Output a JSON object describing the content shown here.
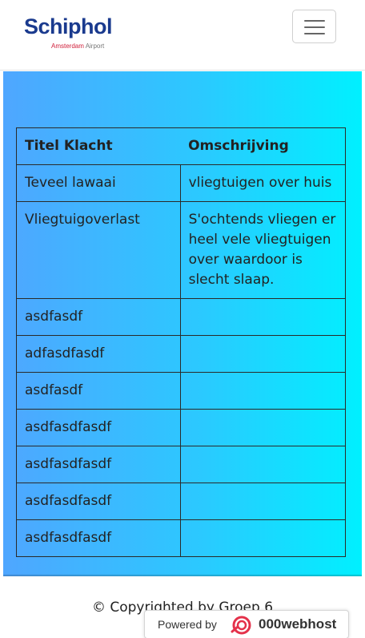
{
  "header": {
    "logo_text": "Schiphol",
    "logo_sub_red": "Amsterdam",
    "logo_sub_grey": "Airport",
    "menu_icon": "hamburger-icon"
  },
  "table": {
    "headers": [
      "Titel Klacht",
      "Omschrijving"
    ],
    "rows": [
      {
        "title": "Teveel lawaai",
        "description": "vliegtuigen over huis"
      },
      {
        "title": "Vliegtuigoverlast",
        "description": "S'ochtends vliegen er heel vele vliegtuigen over waardoor is slecht slaap."
      },
      {
        "title": "asdfasdf",
        "description": ""
      },
      {
        "title": "adfasdfasdf",
        "description": ""
      },
      {
        "title": "asdfasdf",
        "description": ""
      },
      {
        "title": "asdfasdfasdf",
        "description": ""
      },
      {
        "title": "asdfasdfasdf",
        "description": ""
      },
      {
        "title": "asdfasdfasdf",
        "description": ""
      },
      {
        "title": "asdfasdfasdf",
        "description": ""
      }
    ]
  },
  "footer": {
    "copyright": "© Copyrighted by Groep 6",
    "powered_by": "Powered by",
    "host_name": "000webhost",
    "host_icon": "000webhost-logo-icon"
  },
  "colors": {
    "brand_blue": "#1a3a8e",
    "brand_red": "#d0213c",
    "gradient_start": "#4fa6ff",
    "gradient_end": "#00f0ff"
  }
}
